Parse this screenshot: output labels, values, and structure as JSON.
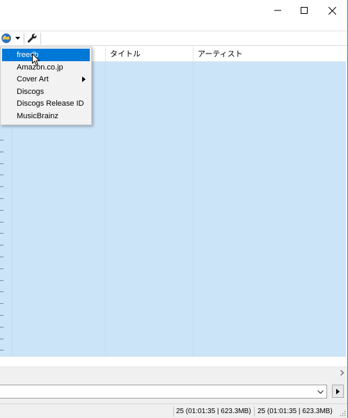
{
  "list": {
    "columns": [
      "タイトル",
      "アーティスト"
    ],
    "row_marker": "..."
  },
  "menu": {
    "items": [
      {
        "label": "freedb",
        "selected": true,
        "submenu": false
      },
      {
        "label": "Amazon.co.jp",
        "selected": false,
        "submenu": false
      },
      {
        "label": "Cover Art",
        "selected": false,
        "submenu": true
      },
      {
        "label": "Discogs",
        "selected": false,
        "submenu": false
      },
      {
        "label": "Discogs Release ID",
        "selected": false,
        "submenu": false
      },
      {
        "label": "MusicBrainz",
        "selected": false,
        "submenu": false
      }
    ]
  },
  "status": {
    "left": "25 (01:01:35 | 623.3MB)",
    "right": "25 (01:01:35 | 623.3MB)"
  },
  "toolbar": {
    "icons": [
      "globe-icon",
      "dropdown-arrow-icon",
      "wrench-icon"
    ]
  },
  "colors": {
    "selection_bg": "#cce4f7",
    "menu_highlight": "#0078d7",
    "window_border": "#2b7cd3"
  }
}
